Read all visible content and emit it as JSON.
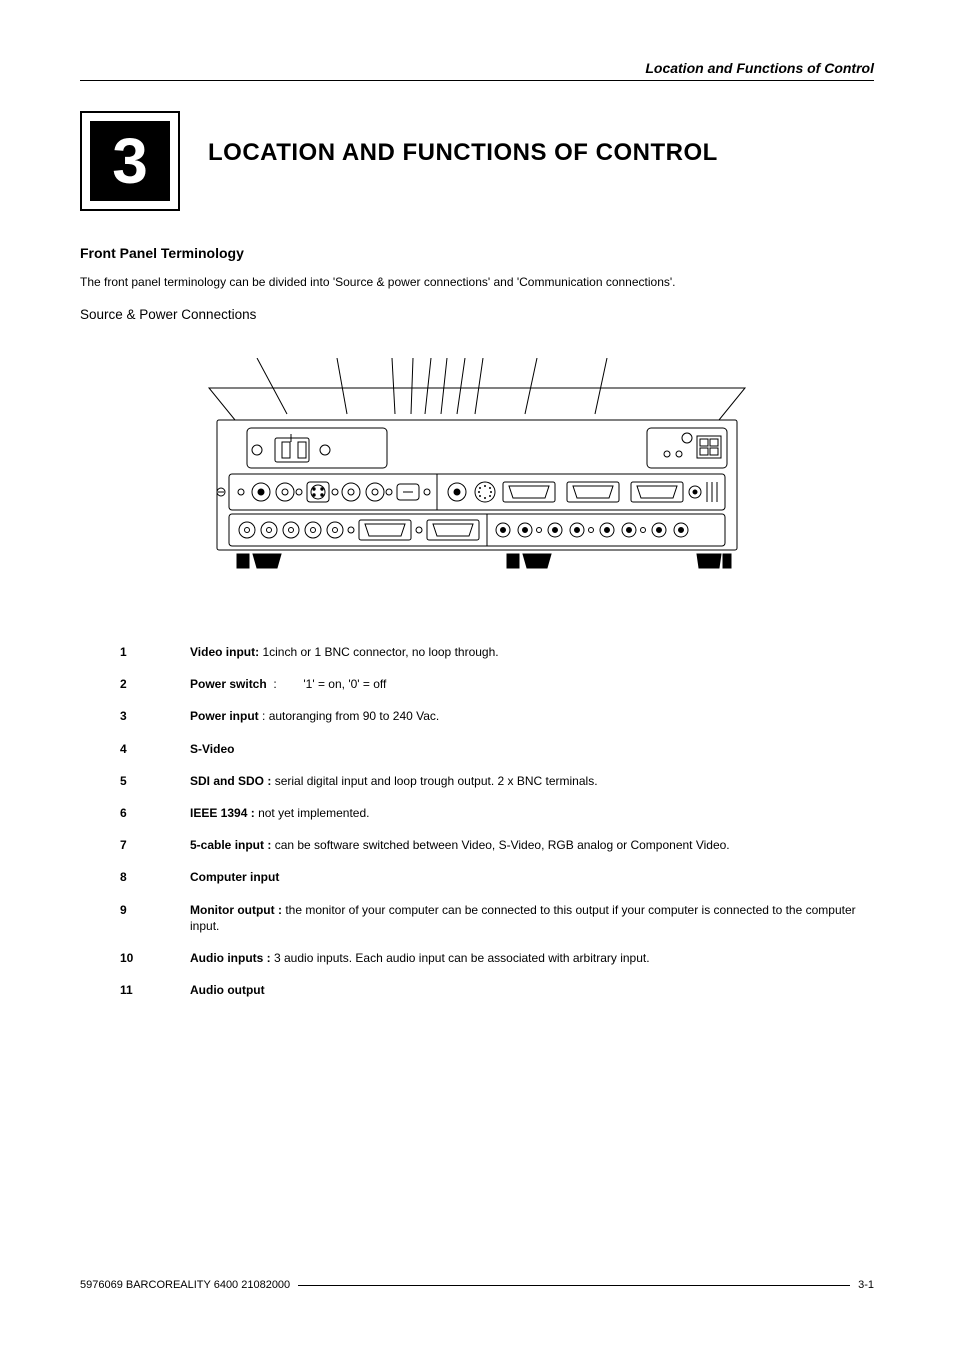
{
  "running_head": "Location and Functions of Control",
  "chapter": {
    "number": "3",
    "title": "LOCATION AND FUNCTIONS OF CONTROL"
  },
  "section_heading": "Front Panel Terminology",
  "intro_text": "The front panel terminology can be divided into 'Source & power connections' and 'Communication connections'.",
  "sub_heading": "Source & Power Connections",
  "items": [
    {
      "num": "1",
      "label": "Video input:",
      "sep": " ",
      "desc": "1cinch or 1 BNC connector, no loop through."
    },
    {
      "num": "2",
      "label": "Power switch",
      "sep": "  :        ",
      "desc": "'1' = on,  '0' = off"
    },
    {
      "num": "3",
      "label": "Power input",
      "sep": " : ",
      "desc": "autoranging from 90 to 240 Vac."
    },
    {
      "num": "4",
      "label": "S-Video",
      "sep": "",
      "desc": ""
    },
    {
      "num": "5",
      "label": "SDI and SDO :",
      "sep": " ",
      "desc": "serial digital input and loop trough output.  2 x BNC terminals."
    },
    {
      "num": "6",
      "label": "IEEE 1394 :",
      "sep": " ",
      "desc": "not yet implemented."
    },
    {
      "num": "7",
      "label": "5-cable input :",
      "sep": " ",
      "desc": "can be software switched between Video, S-Video, RGB analog or Component Video."
    },
    {
      "num": "8",
      "label": "Computer  input",
      "sep": "",
      "desc": ""
    },
    {
      "num": "9",
      "label": "Monitor output :",
      "sep": " ",
      "desc": "the monitor of your computer can be connected to this output if your computer is connected to the computer input."
    },
    {
      "num": "10",
      "label": "Audio inputs :",
      "sep": " ",
      "desc": "3 audio inputs.  Each audio input can be associated with arbitrary input."
    },
    {
      "num": "11",
      "label": "Audio  output",
      "sep": "",
      "desc": ""
    }
  ],
  "footer": {
    "left": "5976069 BARCOREALITY 6400 21082000",
    "right": "3-1"
  }
}
